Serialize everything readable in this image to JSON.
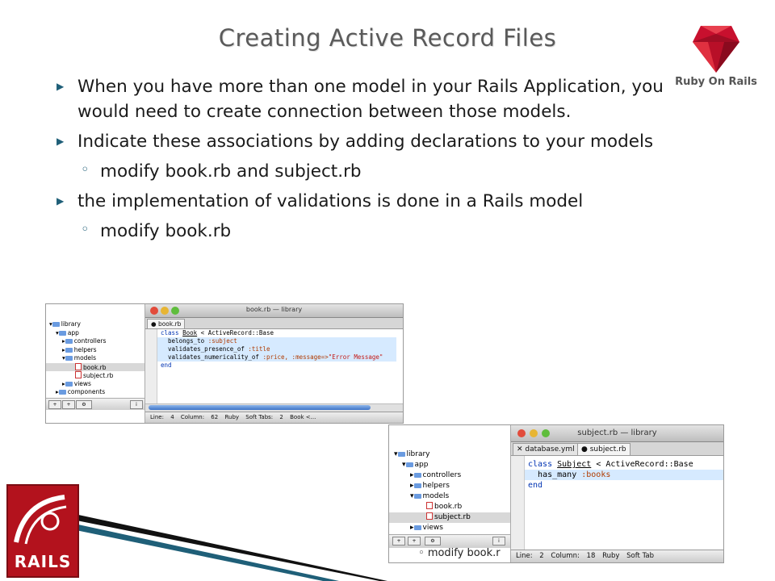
{
  "slide": {
    "title": "Creating Active Record Files",
    "logo_caption": "Ruby On Rails",
    "rails_logo_text": "RAILS",
    "bullets": [
      {
        "text": "When you have more than one model in your Rails Application, you would need to create connection between those models."
      },
      {
        "text": "Indicate these associations by adding declarations to your models",
        "sub": "modify book.rb and subject.rb"
      },
      {
        "text": "the implementation of validations is done in a Rails model",
        "sub": "modify book.rb"
      }
    ],
    "overlap_text": "modify book.r"
  },
  "colors": {
    "accent": "#1f5f78",
    "ruby_red": "#b3121d"
  },
  "window1": {
    "title": "book.rb — library",
    "tab": "book.rb",
    "tree": [
      "library",
      "app",
      "controllers",
      "helpers",
      "models",
      "book.rb",
      "subject.rb",
      "views",
      "components"
    ],
    "code": {
      "l1_kw": "class",
      "l1_cls": "Book",
      "l1_rest": " < ActiveRecord::Base",
      "l2": "belongs_to ",
      "l2_sym": ":subject",
      "l3": "validates_presence_of ",
      "l3_sym": ":title",
      "l4": "validates_numericality_of ",
      "l4_sym": ":price, :message=>",
      "l4_str": "\"Error Message\"",
      "l5": "end"
    },
    "status": {
      "line_label": "Line:",
      "line": "4",
      "col_label": "Column:",
      "col": "62",
      "lang": "Ruby",
      "tabs": "Soft Tabs:",
      "tabs_val": "2",
      "symbol": "Book <..."
    }
  },
  "window2": {
    "title": "subject.rb — library",
    "tabs": [
      "database.yml",
      "subject.rb"
    ],
    "tree": [
      "library",
      "app",
      "controllers",
      "helpers",
      "models",
      "book.rb",
      "subject.rb",
      "views"
    ],
    "code": {
      "l1_kw": "class",
      "l1_cls": "Subject",
      "l1_rest": " < ActiveRecord::Base",
      "l2": "has_many ",
      "l2_sym": ":books",
      "l3": "end"
    },
    "status": {
      "line_label": "Line:",
      "line": "2",
      "col_label": "Column:",
      "col": "18",
      "lang": "Ruby",
      "tabs": "Soft Tab"
    }
  }
}
